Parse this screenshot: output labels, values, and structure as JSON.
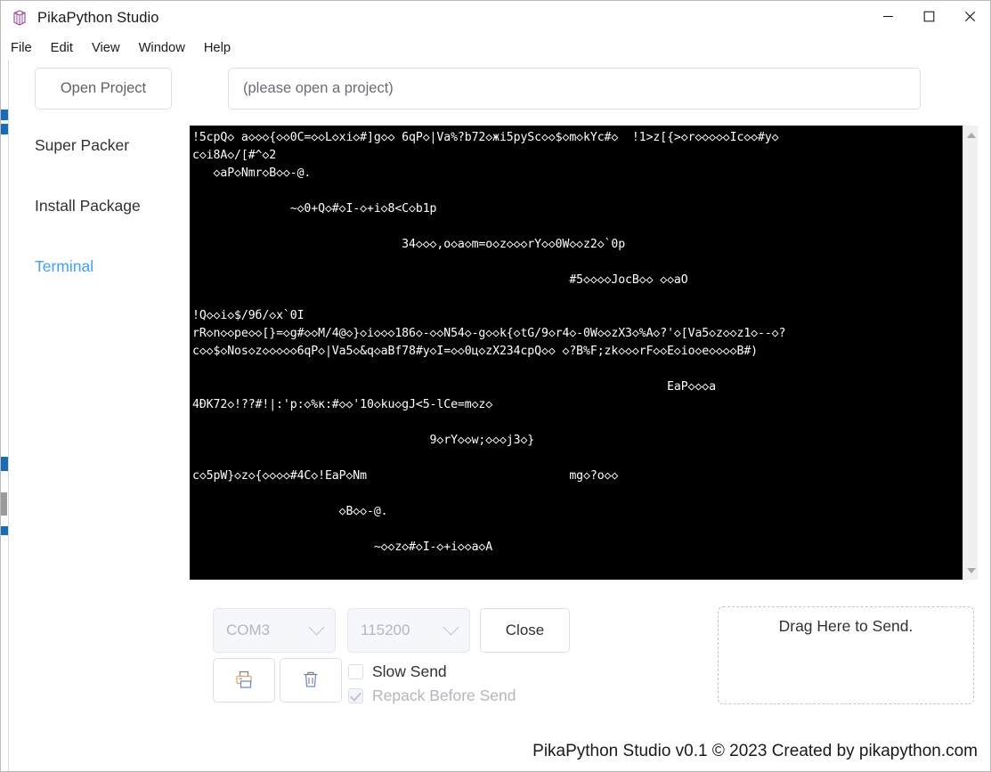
{
  "window": {
    "title": "PikaPython Studio",
    "icon": "cube-icon",
    "controls": {
      "minimize": "minimize-icon",
      "maximize": "maximize-icon",
      "close": "close-icon"
    }
  },
  "menubar": {
    "items": [
      {
        "label": "File"
      },
      {
        "label": "Edit"
      },
      {
        "label": "View"
      },
      {
        "label": "Window"
      },
      {
        "label": "Help"
      }
    ]
  },
  "toolbar": {
    "open_project_label": "Open Project",
    "project_path_value": "",
    "project_path_placeholder": "(please open a project)"
  },
  "sidebar": {
    "items": [
      {
        "label": "Super Packer",
        "active": false
      },
      {
        "label": "Install Package",
        "active": false
      },
      {
        "label": "Terminal",
        "active": true
      }
    ],
    "active_color": "#409eff"
  },
  "terminal": {
    "background": "#000000",
    "foreground": "#ffffff",
    "lines": [
      "!5cpQ◇ a◇◇◇{◇◇0C=◇◇L◇xi◇#]g◇◇ 6qP◇|Va%?b72◇жi5pySc◇◇$◇m◇kYc#◇  !1>z[{>◇r◇◇◇◇◇Ic◇◇#y◇",
      "c◇i8A◇/[#^◇2",
      "   ◇aP◇Nmr◇B◇◇-@.",
      "",
      "              ~◇0+Q◇#◇I-◇+i◇8<C◇b1p",
      "",
      "                              34◇◇◇,o◇a◇m=o◇z◇◇◇rY◇◇0W◇◇z2◇`0p",
      "",
      "                                                      #5◇◇◇◇JocB◇◇ ◇◇aO",
      "",
      "!Q◇◇i◇$/9б/◇x`0I",
      "rR◇n◇◇pe◇◇[}=◇g#◇◇M/4@◇}◇i◇◇◇186◇-◇◇N54◇-g◇◇k{◇tG/9◇r4◇-0W◇◇zX3◇%A◇?'◇[Va5◇z◇◇z1◇--◇?",
      "c◇◇$◇Nos◇z◇◇◇◇◇6qP◇|Va5◇&q◇aBf78#y◇I=◇◇0ц◇zX234cpQ◇◇ ◇?B%F;zk◇◇◇rF◇◇E◇io◇e◇◇◇◇B#)",
      "",
      "                                                                    EaP◇◇◇a",
      "4ĐK72◇!??#!|:'p:◇%к:#◇◇'10◇ku◇gJ<5-lCe=m◇z◇",
      "",
      "                                  9◇rY◇◇w;◇◇◇j3◇}",
      "",
      "c◇5pW}◇z◇{◇◇◇◇#4C◇!EaP◇Nm                             mg◇?o◇◇",
      "",
      "                     ◇B◇◇-@.",
      "",
      "                          ~◇◇z◇#◇I-◇+i◇◇a◇A"
    ],
    "scrollbar": {
      "up_arrow": "scroll-up-arrow",
      "down_arrow": "scroll-down-arrow"
    }
  },
  "serial_controls": {
    "port": {
      "value": "COM3",
      "disabled": true
    },
    "baudrate": {
      "value": "115200",
      "disabled": true
    },
    "close_button": "Close",
    "print_button_icon": "printer-icon",
    "clear_button_icon": "trash-icon",
    "slow_send": {
      "label": "Slow Send",
      "checked": false,
      "disabled": false
    },
    "repack_before_send": {
      "label": "Repack Before Send",
      "checked": true,
      "disabled": true
    }
  },
  "dropzone": {
    "text": "Drag Here to Send."
  },
  "footer": {
    "text": "PikaPython Studio v0.1 © 2023 Created by pikapython.com"
  }
}
